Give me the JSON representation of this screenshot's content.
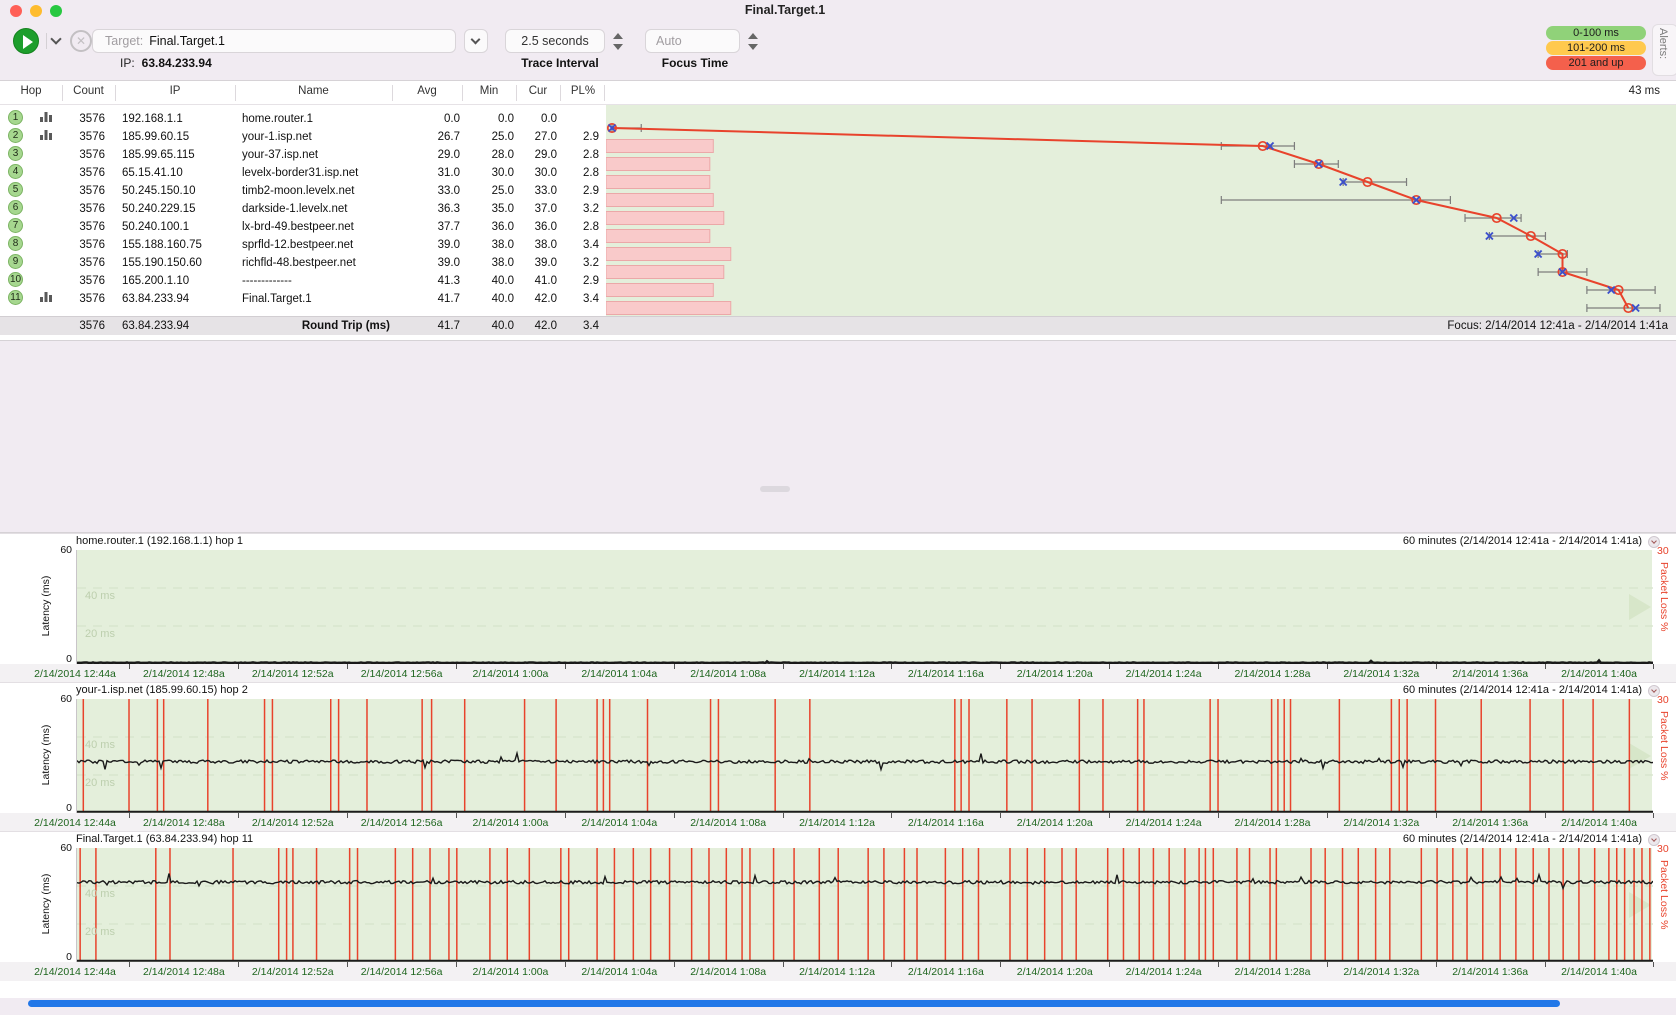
{
  "titlebar": {
    "title": "Final.Target.1"
  },
  "toolbar": {
    "target_label": "Target:",
    "target_value": "Final.Target.1",
    "ip_label": "IP:",
    "ip_value": "63.84.233.94",
    "trace_interval": {
      "value": "2.5 seconds",
      "label": "Trace Interval"
    },
    "focus_time": {
      "value": "Auto",
      "label": "Focus Time"
    },
    "alerts_title": "Alerts:",
    "alert_levels": [
      {
        "label": "0-100 ms",
        "color": "#90d279"
      },
      {
        "label": "101-200 ms",
        "color": "#ffc94e"
      },
      {
        "label": "201 and up",
        "color": "#f4604c"
      }
    ]
  },
  "table": {
    "columns": [
      "Hop",
      "Count",
      "IP",
      "Name",
      "Avg",
      "Min",
      "Cur",
      "PL%"
    ],
    "scale_label": "43 ms",
    "rows": [
      {
        "hop": "1",
        "graph_icon": true,
        "count": "3576",
        "ip": "192.168.1.1",
        "name": "home.router.1",
        "avg": "0.0",
        "min": "0.0",
        "cur": "0.0",
        "pl": ""
      },
      {
        "hop": "2",
        "graph_icon": true,
        "count": "3576",
        "ip": "185.99.60.15",
        "name": "your-1.isp.net",
        "avg": "26.7",
        "min": "25.0",
        "cur": "27.0",
        "pl": "2.9"
      },
      {
        "hop": "3",
        "graph_icon": false,
        "count": "3576",
        "ip": "185.99.65.115",
        "name": "your-37.isp.net",
        "avg": "29.0",
        "min": "28.0",
        "cur": "29.0",
        "pl": "2.8"
      },
      {
        "hop": "4",
        "graph_icon": false,
        "count": "3576",
        "ip": "65.15.41.10",
        "name": "levelx-border31.isp.net",
        "avg": "31.0",
        "min": "30.0",
        "cur": "30.0",
        "pl": "2.8"
      },
      {
        "hop": "5",
        "graph_icon": false,
        "count": "3576",
        "ip": "50.245.150.10",
        "name": "timb2-moon.levelx.net",
        "avg": "33.0",
        "min": "25.0",
        "cur": "33.0",
        "pl": "2.9"
      },
      {
        "hop": "6",
        "graph_icon": false,
        "count": "3576",
        "ip": "50.240.229.15",
        "name": "darkside-1.levelx.net",
        "avg": "36.3",
        "min": "35.0",
        "cur": "37.0",
        "pl": "3.2"
      },
      {
        "hop": "7",
        "graph_icon": false,
        "count": "3576",
        "ip": "50.240.100.1",
        "name": "lx-brd-49.bestpeer.net",
        "avg": "37.7",
        "min": "36.0",
        "cur": "36.0",
        "pl": "2.8"
      },
      {
        "hop": "8",
        "graph_icon": false,
        "count": "3576",
        "ip": "155.188.160.75",
        "name": "sprfld-12.bestpeer.net",
        "avg": "39.0",
        "min": "38.0",
        "cur": "38.0",
        "pl": "3.4"
      },
      {
        "hop": "9",
        "graph_icon": false,
        "count": "3576",
        "ip": "155.190.150.60",
        "name": "richfld-48.bestpeer.net",
        "avg": "39.0",
        "min": "38.0",
        "cur": "39.0",
        "pl": "3.2"
      },
      {
        "hop": "10",
        "graph_icon": false,
        "count": "3576",
        "ip": "165.200.1.10",
        "name": "-------------",
        "avg": "41.3",
        "min": "40.0",
        "cur": "41.0",
        "pl": "2.9"
      },
      {
        "hop": "11",
        "graph_icon": true,
        "count": "3576",
        "ip": "63.84.233.94",
        "name": "Final.Target.1",
        "avg": "41.7",
        "min": "40.0",
        "cur": "42.0",
        "pl": "3.4"
      }
    ],
    "summary": {
      "count": "3576",
      "ip": "63.84.233.94",
      "name": "Round Trip (ms)",
      "avg": "41.7",
      "min": "40.0",
      "cur": "42.0",
      "pl": "3.4"
    },
    "focus_label": "Focus: 2/14/2014 12:41a - 2/14/2014 1:41a"
  },
  "timeline": {
    "range_label": "60 minutes (2/14/2014 12:41a - 2/14/2014 1:41a)",
    "ylabel": "Latency (ms)",
    "y_top": "60",
    "y_bottom": "0",
    "grid_label_40": "40 ms",
    "grid_label_20": "20 ms",
    "right_top": "30",
    "right_label": "Packet Loss %",
    "x_labels": [
      "2/14/2014 12:44a",
      "2/14/2014 12:48a",
      "2/14/2014 12:52a",
      "2/14/2014 12:56a",
      "2/14/2014 1:00a",
      "2/14/2014 1:04a",
      "2/14/2014 1:08a",
      "2/14/2014 1:12a",
      "2/14/2014 1:16a",
      "2/14/2014 1:20a",
      "2/14/2014 1:24a",
      "2/14/2014 1:28a",
      "2/14/2014 1:32a",
      "2/14/2014 1:36a",
      "2/14/2014 1:40a"
    ]
  },
  "chart_data": [
    {
      "type": "scatter",
      "title": "Hop latency trace (circle = avg, x = current, bar = min to max)",
      "xlabel": "Latency (ms)",
      "xlim": [
        0,
        43
      ],
      "x_max_label": "43 ms",
      "loss_bars": {
        "unit": "packet loss %",
        "xlim": [
          0,
          30
        ]
      },
      "hops": [
        {
          "hop": 1,
          "avg": 0.0,
          "min": 0.0,
          "max_est": 1.2,
          "cur": 0.0,
          "pl": null
        },
        {
          "hop": 2,
          "avg": 26.7,
          "min": 25.0,
          "max_est": 28.0,
          "cur": 27.0,
          "pl": 2.9
        },
        {
          "hop": 3,
          "avg": 29.0,
          "min": 28.0,
          "max_est": 29.8,
          "cur": 29.0,
          "pl": 2.8
        },
        {
          "hop": 4,
          "avg": 31.0,
          "min": 30.0,
          "max_est": 32.6,
          "cur": 30.0,
          "pl": 2.8
        },
        {
          "hop": 5,
          "avg": 33.0,
          "min": 25.0,
          "max_est": 34.4,
          "cur": 33.0,
          "pl": 2.9
        },
        {
          "hop": 6,
          "avg": 36.3,
          "min": 35.0,
          "max_est": 37.3,
          "cur": 37.0,
          "pl": 3.2
        },
        {
          "hop": 7,
          "avg": 37.7,
          "min": 36.0,
          "max_est": 38.3,
          "cur": 36.0,
          "pl": 2.8
        },
        {
          "hop": 8,
          "avg": 39.0,
          "min": 38.0,
          "max_est": 39.2,
          "cur": 38.0,
          "pl": 3.4
        },
        {
          "hop": 9,
          "avg": 39.0,
          "min": 38.0,
          "max_est": 40.0,
          "cur": 39.0,
          "pl": 3.2
        },
        {
          "hop": 10,
          "avg": 41.3,
          "min": 40.0,
          "max_est": 42.8,
          "cur": 41.0,
          "pl": 2.9
        },
        {
          "hop": 11,
          "avg": 41.7,
          "min": 40.0,
          "max_est": 43.0,
          "cur": 42.0,
          "pl": 3.4
        }
      ],
      "colors": {
        "avg_line": "#e8432c",
        "cur_marker": "#3c50cc",
        "range_bar": "#7d7d7d",
        "loss_bar_fill": "#f9caca",
        "loss_bar_border": "#eba8a8",
        "background": "#e4efdb"
      }
    },
    {
      "type": "line",
      "title": "home.router.1 (192.168.1.1) hop 1",
      "ylabel": "Latency (ms)",
      "ylim": [
        0,
        60
      ],
      "right_axis_label": "Packet Loss %",
      "right_ylim": [
        0,
        30
      ],
      "baseline_ms": 0.6,
      "loss_event_x": []
    },
    {
      "type": "line",
      "title": "your-1.isp.net (185.99.60.15) hop 2",
      "ylabel": "Latency (ms)",
      "ylim": [
        0,
        60
      ],
      "right_axis_label": "Packet Loss %",
      "right_ylim": [
        0,
        30
      ],
      "baseline_ms": 27,
      "loss_event_x": [
        0.004,
        0.033,
        0.051,
        0.055,
        0.083,
        0.119,
        0.124,
        0.161,
        0.166,
        0.184,
        0.219,
        0.225,
        0.246,
        0.284,
        0.304,
        0.33,
        0.334,
        0.338,
        0.362,
        0.402,
        0.407,
        0.443,
        0.465,
        0.557,
        0.561,
        0.566,
        0.59,
        0.606,
        0.636,
        0.651,
        0.673,
        0.677,
        0.719,
        0.724,
        0.758,
        0.762,
        0.766,
        0.77,
        0.801,
        0.834,
        0.839,
        0.844,
        0.862,
        0.891,
        0.922,
        0.943,
        0.962,
        0.985
      ]
    },
    {
      "type": "line",
      "title": "Final.Target.1 (63.84.233.94) hop 11",
      "ylabel": "Latency (ms)",
      "ylim": [
        0,
        60
      ],
      "right_axis_label": "Packet Loss %",
      "right_ylim": [
        0,
        30
      ],
      "baseline_ms": 42,
      "loss_event_x": [
        0.002,
        0.012,
        0.05,
        0.059,
        0.099,
        0.128,
        0.133,
        0.137,
        0.152,
        0.173,
        0.178,
        0.202,
        0.213,
        0.224,
        0.236,
        0.241,
        0.262,
        0.273,
        0.287,
        0.307,
        0.312,
        0.33,
        0.341,
        0.353,
        0.364,
        0.376,
        0.39,
        0.401,
        0.412,
        0.422,
        0.427,
        0.442,
        0.455,
        0.471,
        0.483,
        0.502,
        0.512,
        0.525,
        0.533,
        0.551,
        0.562,
        0.572,
        0.592,
        0.603,
        0.614,
        0.625,
        0.634,
        0.654,
        0.664,
        0.674,
        0.683,
        0.693,
        0.703,
        0.712,
        0.716,
        0.721,
        0.736,
        0.744,
        0.757,
        0.761,
        0.783,
        0.792,
        0.803,
        0.813,
        0.824,
        0.833,
        0.853,
        0.863,
        0.873,
        0.882,
        0.892,
        0.903,
        0.913,
        0.924,
        0.934,
        0.943,
        0.953,
        0.963,
        0.972,
        0.977,
        0.982,
        0.988,
        0.993,
        0.998
      ]
    }
  ]
}
